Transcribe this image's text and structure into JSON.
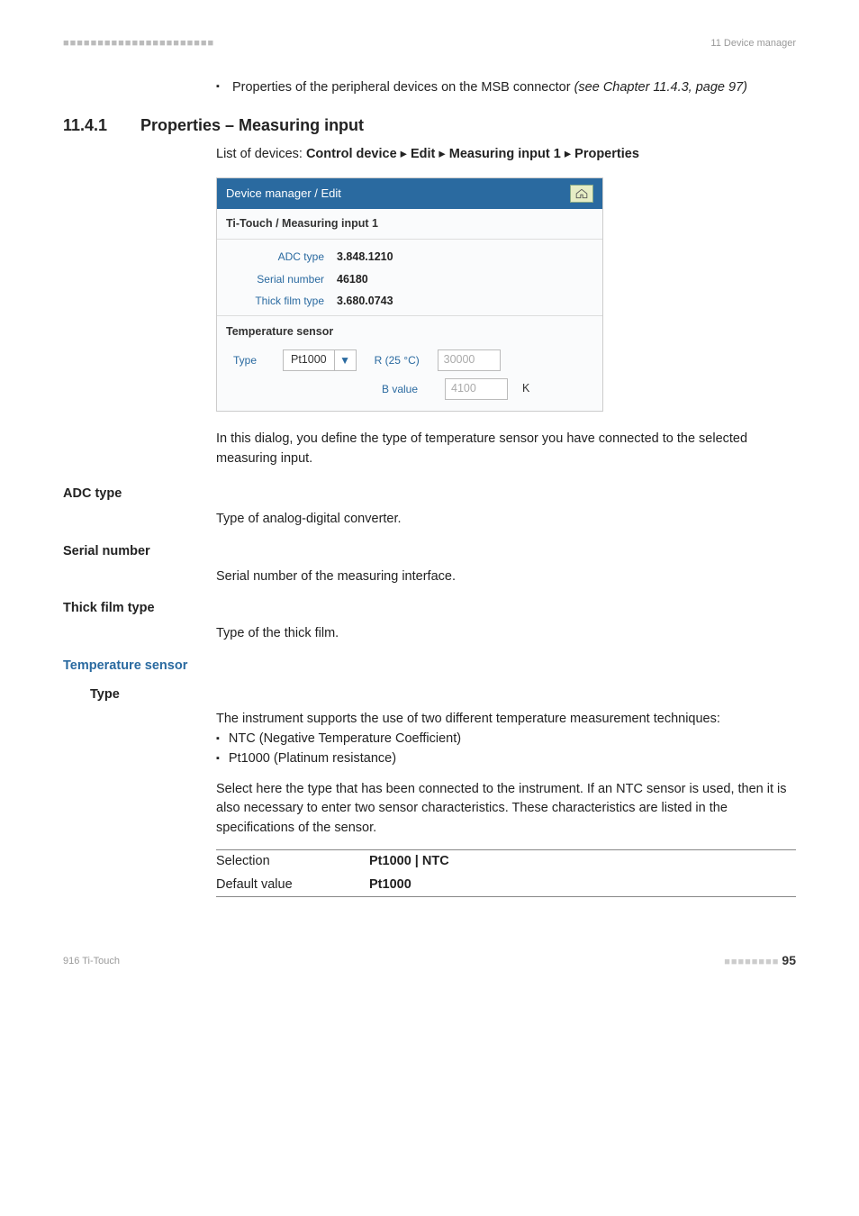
{
  "header": {
    "left_dashes": "■■■■■■■■■■■■■■■■■■■■■■",
    "right": "11 Device manager"
  },
  "intro_bullet": {
    "text": "Properties of the peripheral devices on the MSB connector ",
    "ref": "(see Chapter 11.4.3, page 97)"
  },
  "section": {
    "num": "11.4.1",
    "title": "Properties – Measuring input"
  },
  "path": {
    "prefix": "List of devices: ",
    "segments": [
      "Control device",
      "Edit",
      "Measuring input 1",
      "Properties"
    ]
  },
  "dialog": {
    "title": "Device manager / Edit",
    "subtitle": "Ti-Touch / Measuring input 1",
    "rows": [
      {
        "k": "ADC type",
        "v": "3.848.1210"
      },
      {
        "k": "Serial number",
        "v": "46180"
      },
      {
        "k": "Thick film type",
        "v": "3.680.0743"
      }
    ],
    "group": "Temperature sensor",
    "type_label": "Type",
    "type_value": "Pt1000",
    "r_label": "R (25 °C)",
    "r_value": "30000",
    "b_label": "B value",
    "b_value": "4100",
    "b_unit": "K"
  },
  "post_dialog": "In this dialog, you define the type of temperature sensor you have connected to the selected measuring input.",
  "fields": [
    {
      "name": "ADC type",
      "desc": "Type of analog-digital converter."
    },
    {
      "name": "Serial number",
      "desc": "Serial number of the measuring interface."
    },
    {
      "name": "Thick film type",
      "desc": "Type of the thick film."
    }
  ],
  "subheading": "Temperature sensor",
  "type_field": {
    "name": "Type",
    "desc": "The instrument supports the use of two different temperature measurement techniques:",
    "bullets": [
      "NTC (Negative Temperature Coefficient)",
      "Pt1000 (Platinum resistance)"
    ],
    "para": "Select here the type that has been connected to the instrument. If an NTC sensor is used, then it is also necessary to enter two sensor characteristics. These characteristics are listed in the specifications of the sensor.",
    "table": [
      {
        "k": "Selection",
        "v": "Pt1000 | NTC"
      },
      {
        "k": "Default value",
        "v": "Pt1000"
      }
    ]
  },
  "footer": {
    "left": "916 Ti-Touch",
    "dashes": "■■■■■■■■",
    "page": "95"
  }
}
